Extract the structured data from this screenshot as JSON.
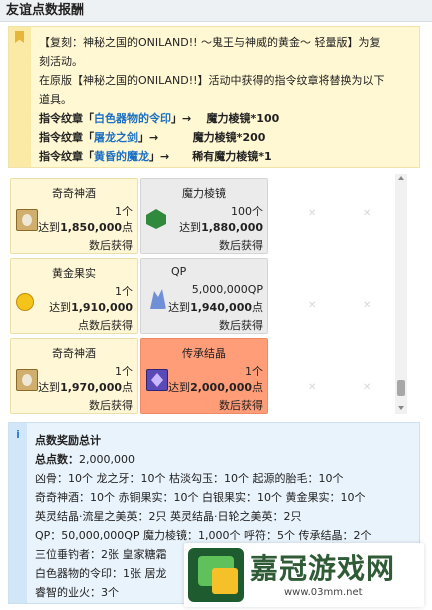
{
  "title": "友谊点数报酬",
  "notice": {
    "line1": "【复刻：神秘之国的ONILAND!! ～鬼王与神威的黄金～ 轻量版】为复",
    "line2": "刻活动。",
    "line3": "在原版【神秘之国的ONILAND!!】活动中获得的指令纹章将替换为以下",
    "line4": "道具。",
    "rows": [
      {
        "prefix": "指令纹章「",
        "name": "白色器物的令印",
        "suffix": "」→",
        "reward": "魔力棱镜*100"
      },
      {
        "prefix": "指令纹章「",
        "name": "屠龙之剑",
        "suffix": "」→",
        "reward": "魔力棱镜*200"
      },
      {
        "prefix": "指令纹章「",
        "name": "黄昏的魔龙",
        "suffix": "」→",
        "reward": "稀有魔力棱镜*1"
      }
    ]
  },
  "cards": [
    {
      "name": "奇奇神酒",
      "count": "1个",
      "reach_prefix": "达到",
      "threshold": "1,850,000",
      "unit": "点",
      "obtain": "数后获得",
      "icon": "wine-jug-icon"
    },
    {
      "name": "魔力棱镜",
      "count": "100个",
      "reach_prefix": "达到",
      "threshold": "1,880,000",
      "unit": "",
      "obtain": "数后获得",
      "icon": "prism-icon"
    },
    {
      "name": "黄金果实",
      "count": "1个",
      "reach_prefix": "达到",
      "threshold": "1,910,000",
      "unit": "",
      "obtain": "点数后获得",
      "icon": "golden-fruit-icon"
    },
    {
      "name": "QP",
      "count": "5,000,000QP",
      "reach_prefix": "达到",
      "threshold": "1,940,000",
      "unit": "点",
      "obtain": "数后获得",
      "icon": "qp-crystal-icon"
    },
    {
      "name": "奇奇神酒",
      "count": "1个",
      "reach_prefix": "达到",
      "threshold": "1,970,000",
      "unit": "点",
      "obtain": "数后获得",
      "icon": "wine-jug-icon"
    },
    {
      "name": "传承结晶",
      "count": "1个",
      "reach_prefix": "达到",
      "threshold": "2,000,000",
      "unit": "点",
      "obtain": "数后获得",
      "icon": "crystal-icon"
    }
  ],
  "summary": {
    "heading": "点数奖励总计",
    "total_label": "总点数：",
    "total_value": "2,000,000",
    "lines": [
      "凶骨：10个  龙之牙：10个  枯淡勾玉：10个  起源的胎毛：10个",
      "奇奇神酒：10个  赤铜果实：10个  白银果实：10个  黄金果实：10个",
      "英灵结晶·流星之美英：2只  英灵结晶·日轮之美英：2只",
      "QP：50,000,000QP  魔力棱镜：1,000个  呼符：5个  传承结晶：2个",
      "三位垂钓者：2张  皇家糖霜",
      "白色器物的令印：1张  居龙",
      "睿智的业火：3个"
    ]
  },
  "watermark": {
    "cn": "嘉冠游戏网",
    "url": "www.03mm.net"
  }
}
